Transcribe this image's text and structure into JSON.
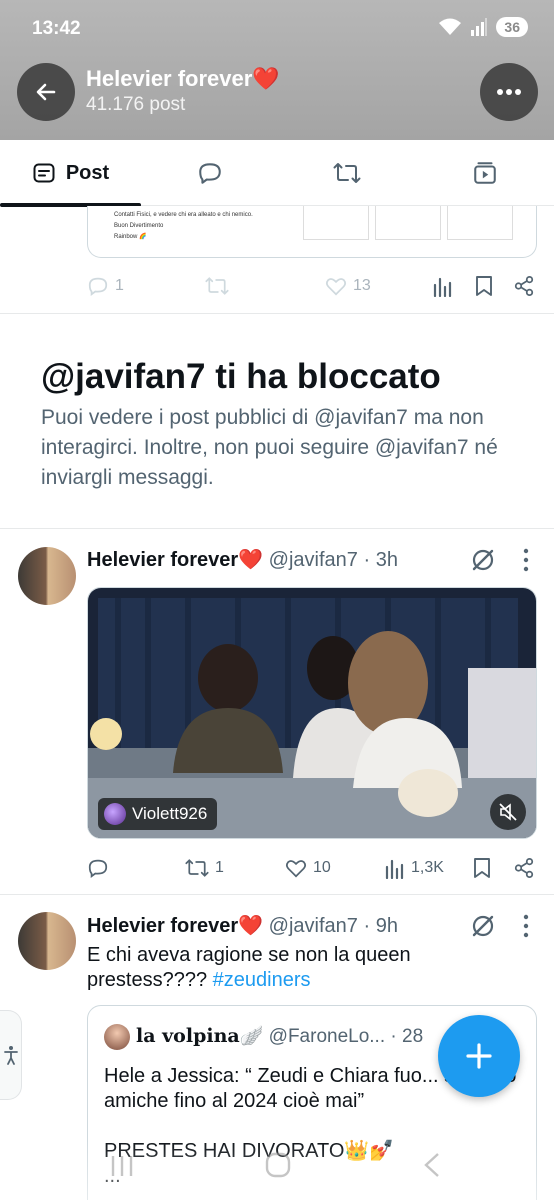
{
  "status_bar": {
    "time": "13:42",
    "battery": "36"
  },
  "header": {
    "name": "Helevier forever",
    "heart": "❤️",
    "post_count": "41.176 post"
  },
  "tabs": [
    {
      "label": "Post",
      "icon": "posts-icon"
    },
    {
      "icon": "replies-icon"
    },
    {
      "icon": "reposts-icon"
    },
    {
      "icon": "media-icon"
    }
  ],
  "prev_tweet": {
    "card_lines": [
      "Contatti Fisici, e vedere chi era alleato e chi nemico.",
      "Buon Divertimento",
      "Rainbow 🌈"
    ],
    "replies": "1",
    "likes": "13"
  },
  "blocked": {
    "title": "@javifan7 ti ha bloccato",
    "description": "Puoi vedere i post pubblici di @javifan7 ma non interagirci. Inoltre, non puoi seguire @javifan7 né inviargli messaggi."
  },
  "tweet1": {
    "name": "Helevier forever",
    "handle": "@javifan7",
    "time": "3h",
    "video_tag": "Violett926",
    "retweets": "1",
    "likes": "10",
    "views": "1,3K"
  },
  "tweet2": {
    "name": "Helevier forever",
    "handle": "@javifan7",
    "time": "9h",
    "text": "E chi aveva ragione se non la queen prestess????",
    "hashtag": "#zeudiners",
    "quote": {
      "name": "la volpina",
      "name_emoji": "🪽",
      "handle": "@FaroneLo...",
      "time": "28",
      "text": "Hele a Jessica: “ Zeudi e Chiara fuo... saranno amiche fino al 2024 cioè mai”\n\nPRESTES HAI DIVORATO👑💅\n..."
    }
  },
  "colors": {
    "accent": "#1d9bf0",
    "heart": "#f0415e",
    "muted": "#536471"
  }
}
